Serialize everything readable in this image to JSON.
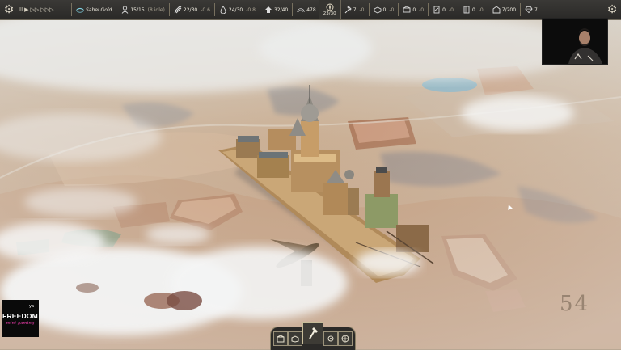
{
  "hud": {
    "speed_controls": [
      "II",
      "▶",
      "▷▷",
      "▷▷▷"
    ],
    "region": "Sahel Gold",
    "stats": [
      {
        "icon": "population-icon",
        "value": "15/15",
        "sub": "(8 idle)"
      },
      {
        "icon": "food-icon",
        "value": "22/30",
        "sub": "-0.6"
      },
      {
        "icon": "water-icon",
        "value": "24/30",
        "sub": "-0.8"
      },
      {
        "icon": "housing-icon",
        "value": "32/40",
        "sub": ""
      },
      {
        "icon": "altitude-icon",
        "value": "478",
        "sub": ""
      }
    ],
    "center_value": "23/30",
    "resources": [
      {
        "icon": "hammer-icon",
        "value": "7",
        "sub": "-0"
      },
      {
        "icon": "wood-icon",
        "value": "0",
        "sub": "-0"
      },
      {
        "icon": "fabric-icon",
        "value": "0",
        "sub": "-0"
      },
      {
        "icon": "paper-icon",
        "value": "0",
        "sub": "-0"
      },
      {
        "icon": "book-icon",
        "value": "0",
        "sub": "-0"
      },
      {
        "icon": "storage-icon",
        "value": "7/200",
        "sub": ""
      },
      {
        "icon": "gem-icon",
        "value": "7",
        "sub": ""
      }
    ]
  },
  "watermark": {
    "line1": "FREEDOM",
    "line2": "mini gaming",
    "mark": "ya"
  },
  "map_number": "54",
  "toolbar": {
    "main_icon": "build-hammer-icon"
  }
}
